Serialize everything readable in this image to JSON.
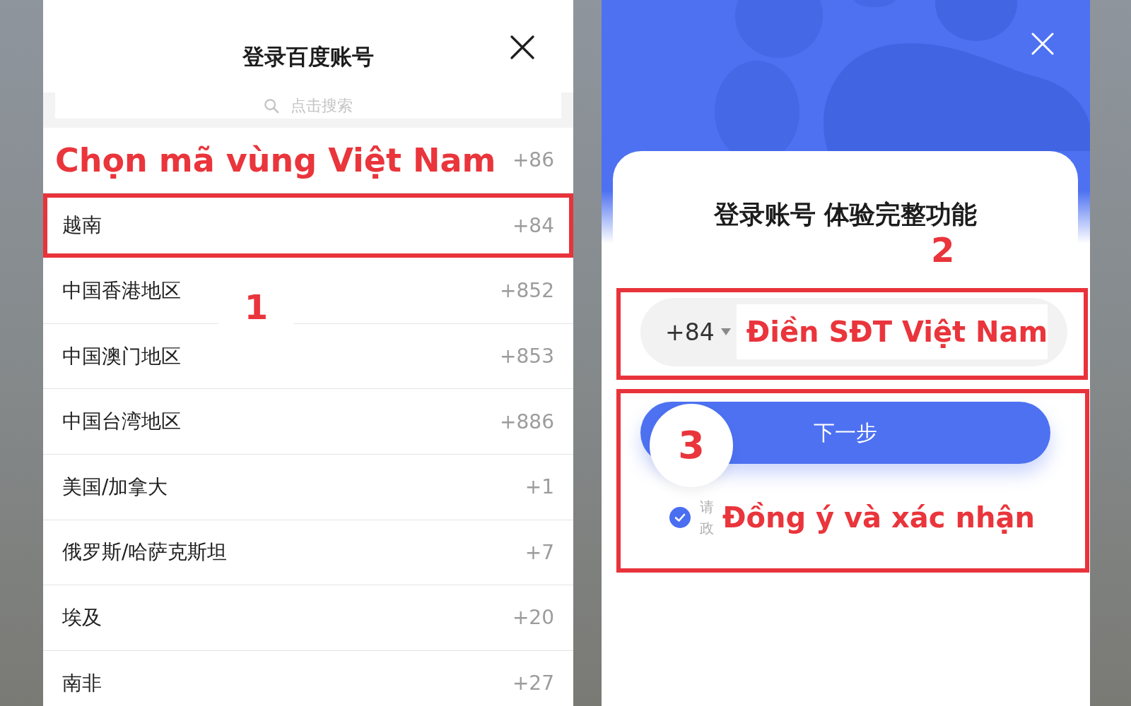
{
  "left_screen": {
    "title": "登录百度账号",
    "search": {
      "placeholder": "点击搜索"
    },
    "countries": [
      {
        "callout": "Chọn mã vùng Việt Nam",
        "code": "+86",
        "selected": false
      },
      {
        "name": "越南",
        "code": "+84",
        "selected": true
      },
      {
        "name": "中国香港地区",
        "code": "+852",
        "selected": false
      },
      {
        "name": "中国澳门地区",
        "code": "+853",
        "selected": false
      },
      {
        "name": "中国台湾地区",
        "code": "+886",
        "selected": false
      },
      {
        "name": "美国/加拿大",
        "code": "+1",
        "selected": false
      },
      {
        "name": "俄罗斯/哈萨克斯坦",
        "code": "+7",
        "selected": false
      },
      {
        "name": "埃及",
        "code": "+20",
        "selected": false
      },
      {
        "name": "南非",
        "code": "+27",
        "selected": false
      }
    ],
    "step_number": "1"
  },
  "right_screen": {
    "title": "登录账号 体验完整功能",
    "phone_section": {
      "step_number": "2",
      "country_code": "+84",
      "callout": "Điền SĐT Việt Nam"
    },
    "confirm_section": {
      "step_number": "3",
      "next_button": "下一步",
      "agreement": {
        "checked": true,
        "lines": [
          "请",
          "政"
        ]
      },
      "callout": "Đồng ý và xác nhận"
    }
  }
}
